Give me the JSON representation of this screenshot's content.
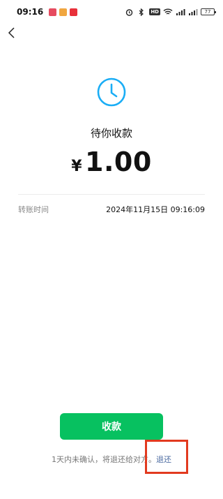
{
  "status_bar": {
    "time": "09:16",
    "battery": "77",
    "hd_label": "HD",
    "notifications": [
      "app-red-1",
      "app-blue-2",
      "app-red-3"
    ]
  },
  "header": {
    "back_icon": "chevron-left-icon"
  },
  "transfer": {
    "status_icon": "clock-icon",
    "status_text": "待你收款",
    "currency": "¥",
    "amount": "1.00"
  },
  "details": {
    "label": "转账时间",
    "value": "2024年11月15日 09:16:09"
  },
  "actions": {
    "receive_label": "收款"
  },
  "footer": {
    "note": "1天内未确认，将退还给对方。",
    "return_link": "退还"
  },
  "colors": {
    "accent_green": "#07c160",
    "clock_blue": "#1aadf5",
    "link_blue": "#4c6ba1",
    "highlight_red": "#e23a1f"
  }
}
